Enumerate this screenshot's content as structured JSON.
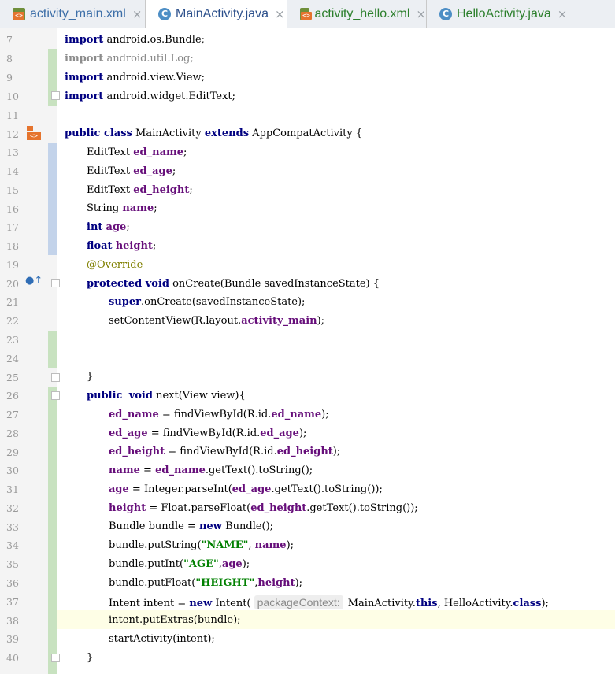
{
  "tabs": [
    {
      "label": "activity_main.xml",
      "icon": "xml-file-icon",
      "close": "×"
    },
    {
      "label": "MainActivity.java",
      "icon": "java-class-icon",
      "glyph": "C",
      "close": "×"
    },
    {
      "label": "activity_hello.xml",
      "icon": "xml-file-icon",
      "close": "×"
    },
    {
      "label": "HelloActivity.java",
      "icon": "java-class-icon",
      "glyph": "C",
      "close": "×"
    }
  ],
  "line_numbers": [
    "7",
    "8",
    "9",
    "10",
    "11",
    "12",
    "13",
    "14",
    "15",
    "16",
    "17",
    "18",
    "19",
    "20",
    "21",
    "22",
    "23",
    "24",
    "25",
    "26",
    "27",
    "28",
    "29",
    "30",
    "31",
    "32",
    "33",
    "34",
    "35",
    "36",
    "37",
    "38",
    "39",
    "40"
  ],
  "code": {
    "l7": {
      "kw": "import",
      "rest": " android.os.Bundle;"
    },
    "l8": {
      "kw": "import",
      "rest": " android.util.Log;"
    },
    "l9": {
      "kw": "import",
      "rest": " android.view.View;"
    },
    "l10": {
      "kw": "import",
      "rest": " android.widget.EditText;"
    },
    "l12": {
      "kw1": "public class",
      "t1": " MainActivity ",
      "kw2": "extends",
      "t2": " AppCompatActivity {"
    },
    "l13": {
      "type": "EditText ",
      "field": "ed_name",
      "end": ";"
    },
    "l14": {
      "type": "EditText ",
      "field": "ed_age",
      "end": ";"
    },
    "l15": {
      "type": "EditText ",
      "field": "ed_height",
      "end": ";"
    },
    "l16": {
      "type": "String ",
      "field": "name",
      "end": ";"
    },
    "l17": {
      "kw": "int",
      "sp": " ",
      "field": "age",
      "end": ";"
    },
    "l18": {
      "kw": "float",
      "sp": " ",
      "field": "height",
      "end": ";"
    },
    "l19": {
      "ann": "@Override"
    },
    "l20": {
      "kw": "protected void",
      "rest": " onCreate(Bundle savedInstanceState) {"
    },
    "l21": {
      "kw": "super",
      "rest": ".onCreate(savedInstanceState);"
    },
    "l22": {
      "t1": "setContentView(R.layout.",
      "field": "activity_main",
      "end": ");"
    },
    "l25": {
      "text": "}"
    },
    "l26": {
      "kw1": "public",
      "sp": "  ",
      "kw2": "void",
      "rest": " next(View view){"
    },
    "l27": {
      "f1": "ed_name",
      "t1": " = findViewById(R.id.",
      "f2": "ed_name",
      "end": ");"
    },
    "l28": {
      "f1": "ed_age",
      "t1": " = findViewById(R.id.",
      "f2": "ed_age",
      "end": ");"
    },
    "l29": {
      "f1": "ed_height",
      "t1": " = findViewById(R.id.",
      "f2": "ed_height",
      "end": ");"
    },
    "l30": {
      "f1": "name",
      "t1": " = ",
      "f2": "ed_name",
      "end": ".getText().toString();"
    },
    "l31": {
      "f1": "age",
      "t1": " = Integer.parseInt(",
      "f2": "ed_age",
      "end": ".getText().toString());"
    },
    "l32": {
      "f1": "height",
      "t1": " = Float.parseFloat(",
      "f2": "ed_height",
      "end": ".getText().toString());"
    },
    "l33": {
      "t1": "Bundle bundle = ",
      "kw": "new",
      "end": " Bundle();"
    },
    "l34": {
      "t1": "bundle.putString(",
      "s": "\"NAME\"",
      "t2": ", ",
      "f": "name",
      "end": ");"
    },
    "l35": {
      "t1": "bundle.putInt(",
      "s": "\"AGE\"",
      "t2": ",",
      "f": "age",
      "end": ");"
    },
    "l36": {
      "t1": "bundle.putFloat(",
      "s": "\"HEIGHT\"",
      "t2": ",",
      "f": "height",
      "end": ");"
    },
    "l37": {
      "t1": "Intent intent = ",
      "kw": "new",
      "t2": " Intent( ",
      "hint": "packageContext:",
      "t3": "MainActivity.",
      "kw2": "this",
      "t4": ", HelloActivity.",
      "kw3": "class",
      "end": ");"
    },
    "l38": {
      "text": "intent.putExtras(bundle);"
    },
    "l39": {
      "text": "startActivity(intent);"
    },
    "l40": {
      "text": "}"
    }
  },
  "colors": {
    "keyword": "#000080",
    "field": "#660e7a",
    "string": "#008000",
    "annotation": "#808000"
  }
}
